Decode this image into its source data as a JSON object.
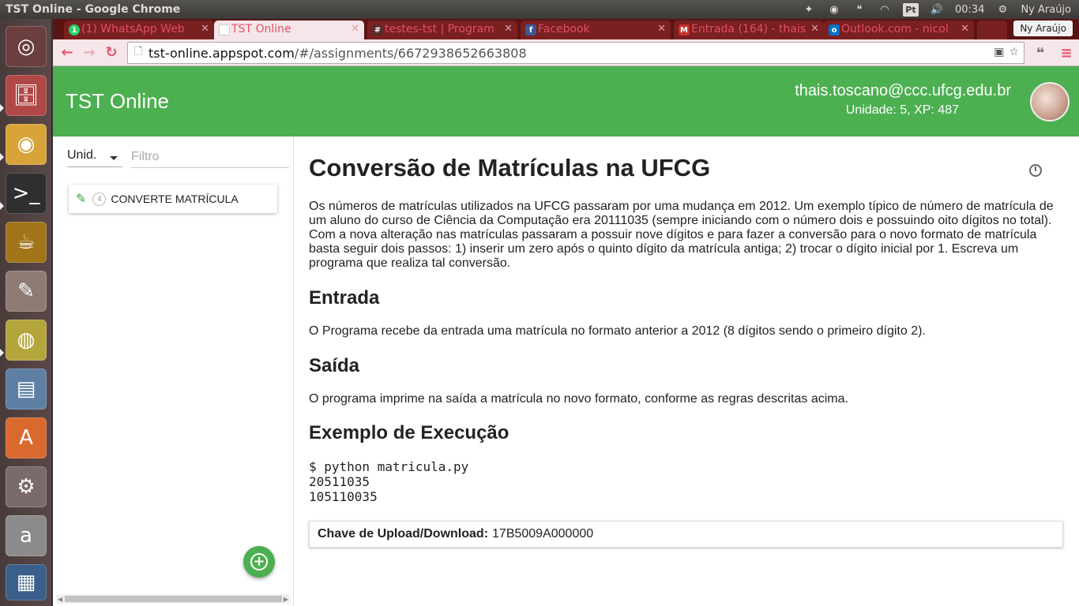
{
  "os": {
    "window_title": "TST Online - Google Chrome",
    "clock": "00:34",
    "user": "Ny Araújo",
    "keyboard_layout": "Pt"
  },
  "launcher": {
    "items": [
      {
        "name": "ubuntu-dash",
        "icon": "ubuntu-logo-icon"
      },
      {
        "name": "files",
        "icon": "file-cabinet-icon"
      },
      {
        "name": "chrome",
        "icon": "chrome-icon"
      },
      {
        "name": "terminal",
        "icon": "terminal-icon"
      },
      {
        "name": "teapot",
        "icon": "teapot-icon"
      },
      {
        "name": "text-editor",
        "icon": "text-editor-icon"
      },
      {
        "name": "speaker",
        "icon": "speaker-icon"
      },
      {
        "name": "impress",
        "icon": "presentation-icon"
      },
      {
        "name": "software-center",
        "icon": "software-center-icon"
      },
      {
        "name": "settings",
        "icon": "settings-icon"
      },
      {
        "name": "amazon",
        "icon": "amazon-icon"
      }
    ]
  },
  "browser": {
    "tabs": [
      {
        "label": "(1) WhatsApp Web",
        "fav": "1",
        "fav_color": "#25d366"
      },
      {
        "label": "TST Online",
        "fav": "",
        "fav_color": "#f4e6e9"
      },
      {
        "label": "testes-tst | Program",
        "fav": "#",
        "fav_color": "#5a2b2b"
      },
      {
        "label": "Facebook",
        "fav": "f",
        "fav_color": "#3b5998"
      },
      {
        "label": "Entrada (164) - thais",
        "fav": "M",
        "fav_color": "#c43428"
      },
      {
        "label": "Outlook.com - nicol",
        "fav": "o",
        "fav_color": "#0072c6"
      }
    ],
    "profile": "Ny Araújo",
    "url_host": "tst-online.appspot.com",
    "url_path": "/#/assignments/6672938652663808"
  },
  "app": {
    "title": "TST Online",
    "user_email": "thais.toscano@ccc.ufcg.edu.br",
    "user_stats": "Unidade: 5, XP: 487"
  },
  "sidebar": {
    "unit_select": "Unid.",
    "filter_placeholder": "Filtro",
    "assignments": [
      {
        "unit": "4",
        "label": "CONVERTE MATRÍCULA"
      }
    ]
  },
  "problem": {
    "title": "Conversão de Matrículas na UFCG",
    "description": "Os números de matrículas utilizados na UFCG passaram por uma mudança em 2012. Um exemplo típico de número de matrícula de um aluno do curso de Ciência da Computação era 20111035 (sempre iniciando com o número dois e possuindo oito dígitos no total). Com a nova alteração nas matrículas passaram a possuir nove dígitos e para fazer a conversão para o novo formato de matrícula basta seguir dois passos: 1) inserir um zero após o quinto dígito da matrícula antiga; 2) trocar o dígito inicial por 1. Escreva um programa que realiza tal conversão.",
    "input_heading": "Entrada",
    "input_text": "O Programa recebe da entrada uma matrícula no formato anterior a 2012 (8 dígitos sendo o primeiro dígito 2).",
    "output_heading": "Saída",
    "output_text": "O programa imprime na saída a matrícula no novo formato, conforme as regras descritas acima.",
    "example_heading": "Exemplo de Execução",
    "example_lines": "$ python matricula.py\n20511035\n105110035",
    "key_label": "Chave de Upload/Download:",
    "key_value": "17B5009A000000"
  }
}
